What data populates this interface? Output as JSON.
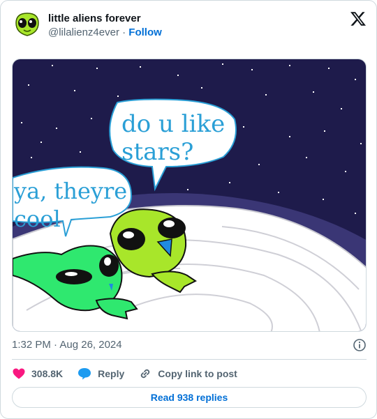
{
  "user": {
    "display_name": "little aliens forever",
    "handle": "@lilalienz4ever",
    "separator": "·",
    "follow_label": "Follow"
  },
  "media": {
    "bubble_top_line1": "do u like",
    "bubble_top_line2": "stars?",
    "bubble_left_line1": "ya, theyre",
    "bubble_left_line2": "cool"
  },
  "meta": {
    "timestamp": "1:32 PM · Aug 26, 2024"
  },
  "actions": {
    "likes": "308.8K",
    "reply_label": "Reply",
    "copy_label": "Copy link to post"
  },
  "replies": {
    "label": "Read 938 replies"
  },
  "colors": {
    "brand_blue": "#006fd6",
    "like_pink": "#f91880",
    "reply_blue": "#1d9bf0",
    "space": "#1e1b4b",
    "alien_lime": "#a8e62a",
    "alien_green": "#2fe86f"
  }
}
